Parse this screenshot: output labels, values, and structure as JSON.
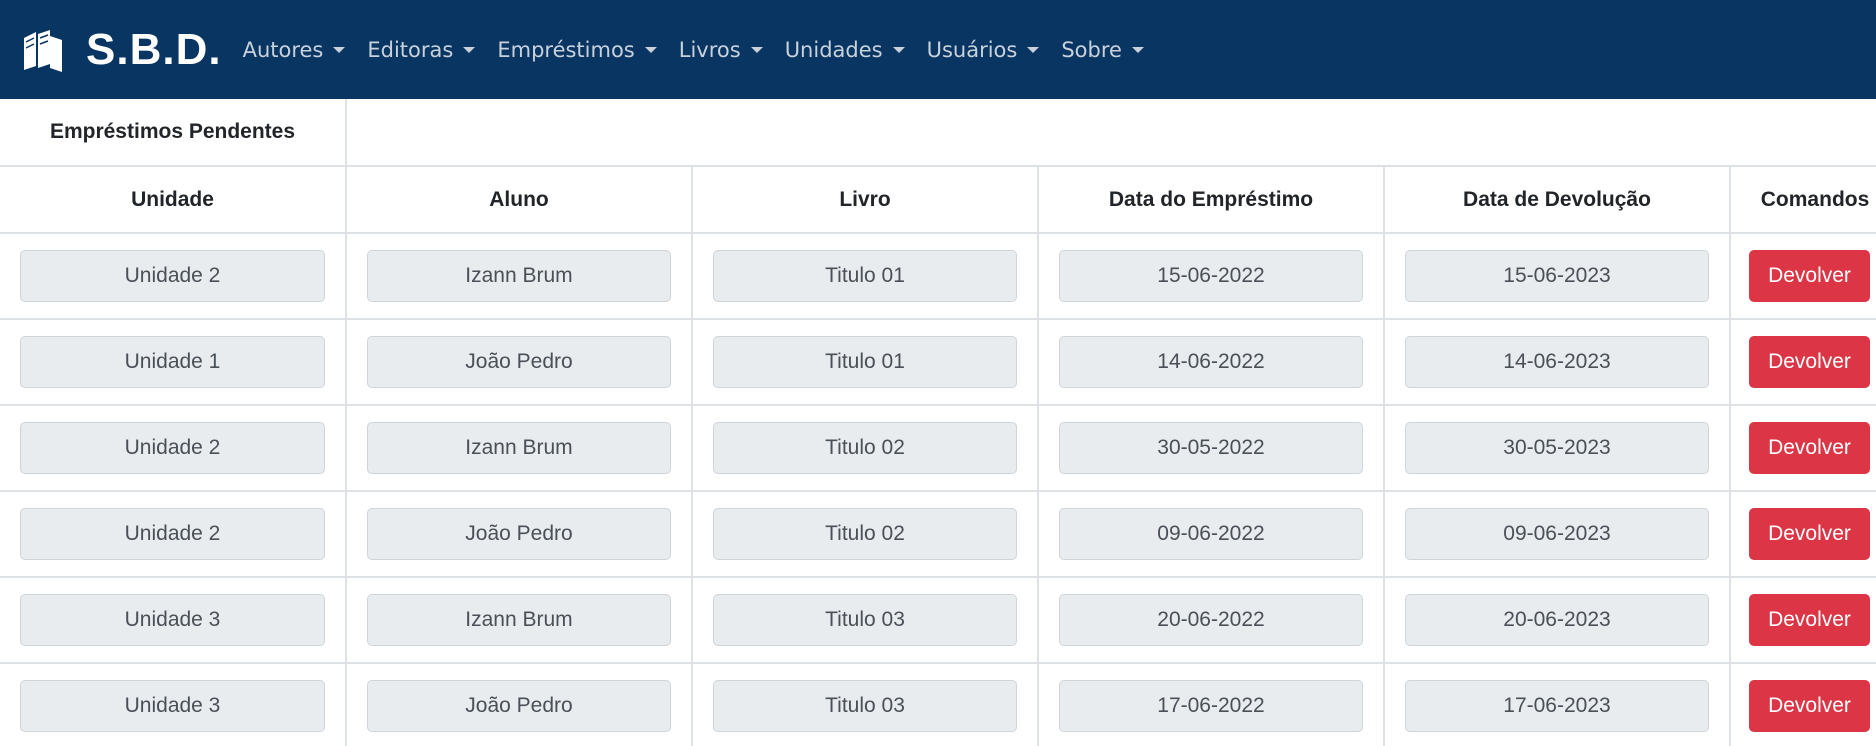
{
  "navbar": {
    "brand": "S.B.D.",
    "logo_icon": "books-icon",
    "items": [
      {
        "label": "Autores"
      },
      {
        "label": "Editoras"
      },
      {
        "label": "Empréstimos"
      },
      {
        "label": "Livros"
      },
      {
        "label": "Unidades"
      },
      {
        "label": "Usuários"
      },
      {
        "label": "Sobre"
      }
    ],
    "background": "#083562"
  },
  "table": {
    "title": "Empréstimos Pendentes",
    "columns": [
      "Unidade",
      "Aluno",
      "Livro",
      "Data do Empréstimo",
      "Data de Devolução",
      "Comandos"
    ],
    "rows": [
      {
        "unidade": "Unidade 2",
        "aluno": "Izann Brum",
        "livro": "Titulo 01",
        "emprestimo": "15-06-2022",
        "devolucao": "15-06-2023",
        "action": "Devolver"
      },
      {
        "unidade": "Unidade 1",
        "aluno": "João Pedro",
        "livro": "Titulo 01",
        "emprestimo": "14-06-2022",
        "devolucao": "14-06-2023",
        "action": "Devolver"
      },
      {
        "unidade": "Unidade 2",
        "aluno": "Izann Brum",
        "livro": "Titulo 02",
        "emprestimo": "30-05-2022",
        "devolucao": "30-05-2023",
        "action": "Devolver"
      },
      {
        "unidade": "Unidade 2",
        "aluno": "João Pedro",
        "livro": "Titulo 02",
        "emprestimo": "09-06-2022",
        "devolucao": "09-06-2023",
        "action": "Devolver"
      },
      {
        "unidade": "Unidade 3",
        "aluno": "Izann Brum",
        "livro": "Titulo 03",
        "emprestimo": "20-06-2022",
        "devolucao": "20-06-2023",
        "action": "Devolver"
      },
      {
        "unidade": "Unidade 3",
        "aluno": "João Pedro",
        "livro": "Titulo 03",
        "emprestimo": "17-06-2022",
        "devolucao": "17-06-2023",
        "action": "Devolver"
      }
    ],
    "action_color": "#dc3545"
  }
}
